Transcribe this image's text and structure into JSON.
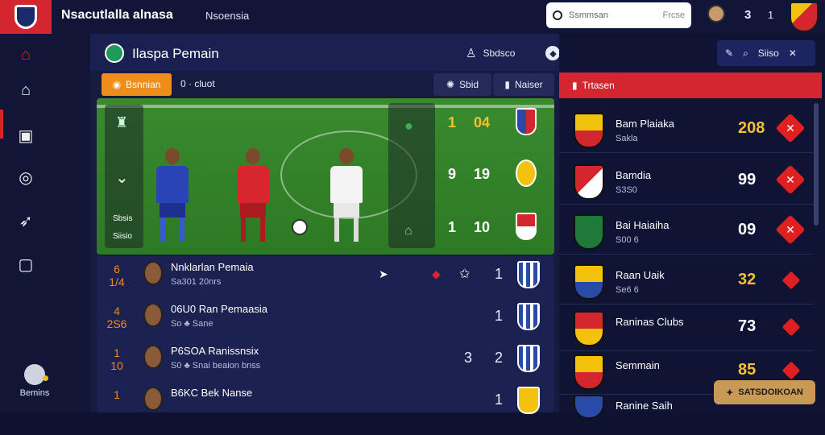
{
  "header": {
    "title": "Nsacutlalla alnasa",
    "subtitle": "Nsoensia",
    "search_placeholder": "Ssmmsan",
    "search_hint": "Frcse",
    "count_a": "3",
    "count_b": "1"
  },
  "sidebar": {
    "items": [
      "home-outline",
      "home",
      "chat",
      "target",
      "whistle",
      "square"
    ],
    "bottom_label": "Bemins"
  },
  "main": {
    "title": "Ilaspa Pemain",
    "header_actions": {
      "label": "Sbdsco"
    },
    "tabs": [
      {
        "label": "Bsnnian"
      },
      {
        "label": "0 · cluot"
      },
      {
        "label": "Sbid"
      },
      {
        "label": "Naiser"
      }
    ],
    "pitch": {
      "left_text_1": "Sbsis",
      "left_text_2": "Siisio",
      "scores": [
        {
          "a": "1",
          "b": "04"
        },
        {
          "a": "9",
          "b": "19"
        },
        {
          "a": "1",
          "b": "10"
        }
      ]
    },
    "players": [
      {
        "rank": "6\n1/4",
        "name": "Nnklarlan Pemaia",
        "detail": "Sa301 20nrs",
        "value": "1",
        "value2": ""
      },
      {
        "rank": "4\n2S6",
        "name": "06U0 Ran Pemaasia",
        "detail": "So  ♣ Sane",
        "value": "1",
        "value2": ""
      },
      {
        "rank": "1\n10",
        "name": "P6SOA Ranissnsix",
        "detail": "S0  ♣ Snai beaion bnss",
        "value": "2",
        "value2": "3"
      },
      {
        "rank": "1",
        "name": "B6KC Bek Nanse",
        "detail": "",
        "value": "1",
        "value2": ""
      }
    ]
  },
  "right": {
    "header_label": "Siiso",
    "tab_label": "Trtasen",
    "rows": [
      {
        "name": "Bam Plaiaka",
        "sub": "Sakla",
        "score": "208"
      },
      {
        "name": "Bamdia",
        "sub": "S3S0",
        "score": "99"
      },
      {
        "name": "Bai Haiaiha",
        "sub": "S00 6",
        "score": "09"
      },
      {
        "name": "Raan Uaik",
        "sub": "Se6 6",
        "score": "32"
      },
      {
        "name": "Raninas Clubs",
        "sub": "",
        "score": "73"
      },
      {
        "name": "Semmain",
        "sub": "",
        "score": "85"
      },
      {
        "name": "Ranine Saih",
        "sub": "",
        "score": ""
      }
    ],
    "cta_label": "SATSDOIKOAN"
  },
  "colors": {
    "accent": "#d3262e",
    "orange": "#f08c1a",
    "gold": "#f2c230"
  }
}
